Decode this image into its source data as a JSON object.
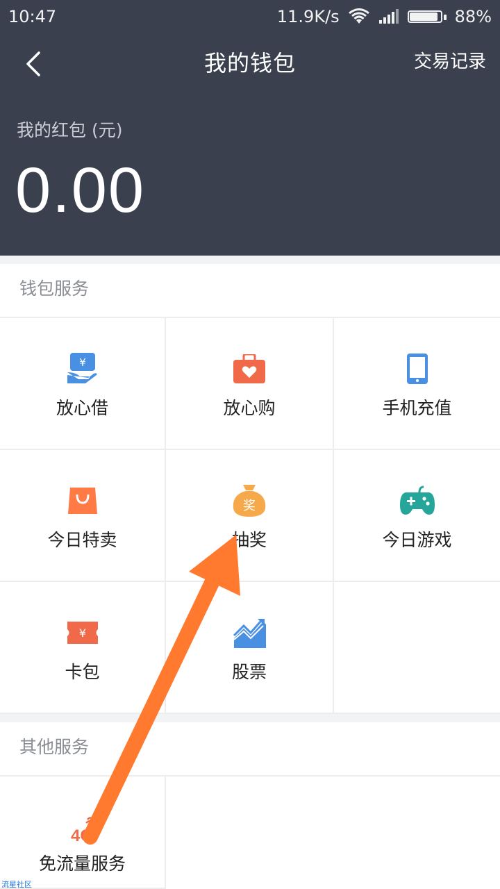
{
  "status_bar": {
    "time": "10:47",
    "net_speed": "11.9K/s",
    "battery": "88%"
  },
  "nav": {
    "title": "我的钱包",
    "action": "交易记录",
    "back_icon": "chevron-left-icon"
  },
  "balance": {
    "label": "我的红包 (元)",
    "amount": "0.00"
  },
  "wallet_services": {
    "title": "钱包服务",
    "items": [
      {
        "label": "放心借",
        "icon": "loan-hand-icon",
        "color": "#4a90e2"
      },
      {
        "label": "放心购",
        "icon": "shopping-case-heart-icon",
        "color": "#f06a4a"
      },
      {
        "label": "手机充值",
        "icon": "phone-icon",
        "color": "#4a90e2"
      },
      {
        "label": "今日特卖",
        "icon": "shopping-bag-icon",
        "color": "#ff7a45"
      },
      {
        "label": "抽奖",
        "icon": "lottery-bag-icon",
        "color": "#f5a94a"
      },
      {
        "label": "今日游戏",
        "icon": "gamepad-icon",
        "color": "#26a69a"
      },
      {
        "label": "卡包",
        "icon": "ticket-icon",
        "color": "#f06a4a"
      },
      {
        "label": "股票",
        "icon": "stock-chart-icon",
        "color": "#4a90e2"
      }
    ]
  },
  "other_services": {
    "title": "其他服务",
    "items": [
      {
        "label": "免流量服务",
        "icon": "4g-icon",
        "color": "#f06a4a",
        "icon_text": "4G"
      }
    ]
  },
  "watermark": "流星社区",
  "colors": {
    "header_bg": "#3b404f",
    "page_bg": "#f2f3f5",
    "arrow": "#ff7a2e"
  }
}
